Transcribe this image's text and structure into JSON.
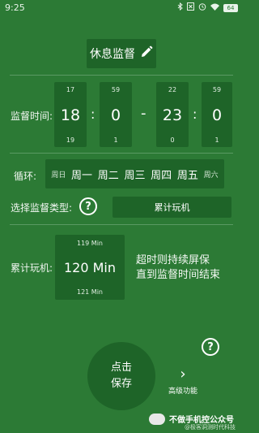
{
  "status_bar": {
    "time": "9:25",
    "icons": [
      "bluetooth-icon",
      "sim-icon",
      "alarm-icon",
      "wifi-icon",
      "battery-icon"
    ],
    "battery": "64"
  },
  "title": {
    "label": "休息监督",
    "icon": "pencil-icon"
  },
  "monitor_time": {
    "label": "监督时间:",
    "start_hour": {
      "above": "17",
      "value": "18",
      "below": "19"
    },
    "start_minute": {
      "above": "59",
      "value": "0",
      "below": "1"
    },
    "end_hour": {
      "above": "22",
      "value": "23",
      "below": "0"
    },
    "end_minute": {
      "above": "59",
      "value": "0",
      "below": "1"
    },
    "separator": ":",
    "range_separator": "-"
  },
  "cycle": {
    "label": "循环:",
    "days": [
      {
        "label": "周日",
        "selected": false
      },
      {
        "label": "周一",
        "selected": true
      },
      {
        "label": "周二",
        "selected": true
      },
      {
        "label": "周三",
        "selected": true
      },
      {
        "label": "周四",
        "selected": true
      },
      {
        "label": "周五",
        "selected": true
      },
      {
        "label": "周六",
        "selected": false
      }
    ]
  },
  "monitor_type": {
    "label": "选择监督类型:",
    "help_icon": "question-circle-icon",
    "selected": "累计玩机"
  },
  "play_time": {
    "label": "累计玩机:",
    "above": "119 Min",
    "value": "120 Min",
    "below": "121 Min",
    "hint_line1": "超时则持续屏保",
    "hint_line2": "直到监督时间结束"
  },
  "help2_icon": "question-circle-icon",
  "save": {
    "line1": "点击",
    "line2": "保存"
  },
  "advanced": {
    "chevron": "›",
    "label": "高级功能"
  },
  "watermark": {
    "title": "不做手机控公众号",
    "subtitle": "@极客洞测时代科技"
  },
  "colors": {
    "background": "#2c7a35",
    "panel": "#1e6428",
    "text": "#ffffff"
  }
}
